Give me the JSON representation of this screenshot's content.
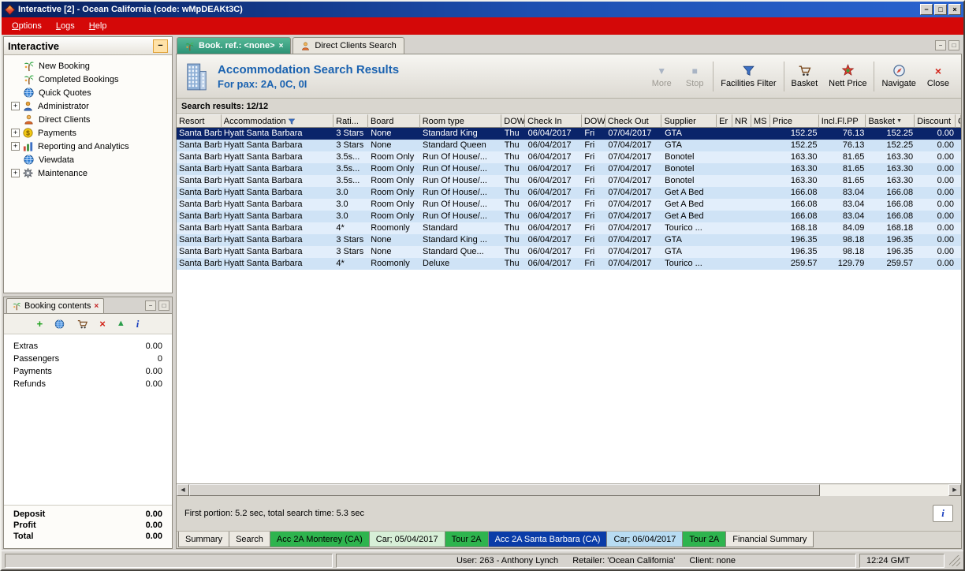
{
  "window": {
    "title": "Interactive [2] - Ocean California (code: wMpDEAKt3C)",
    "status_user": "User: 263 - Anthony Lynch",
    "status_retailer": "Retailer: 'Ocean California'",
    "status_client": "Client: none",
    "time": "12:24 GMT"
  },
  "colors": {
    "titlebar": "#0a2a6e",
    "menubar_red": "#d40808",
    "accent_blue": "#1a62b0",
    "selected_row": "#0a246a",
    "active_doc_tab_green": "#35a081",
    "bottom_tab_green": "#2eb44e",
    "bottom_tab_active_blue": "#0a3ca8",
    "bottom_tab_pale_blue": "#b8dcf2"
  },
  "icons": {
    "minimize": "−",
    "maximize": "□",
    "close": "×",
    "expander": "+",
    "more": "▼",
    "stop": "■",
    "tab_close": "×",
    "add": "+",
    "remove": "×",
    "move_up": "▲",
    "info": "i",
    "scroll_left": "◀",
    "scroll_right": "▶",
    "sort": "▼"
  },
  "menu": {
    "items": [
      {
        "label": "Options"
      },
      {
        "label": "Logs"
      },
      {
        "label": "Help"
      }
    ]
  },
  "sidebar": {
    "title": "Interactive",
    "items": [
      {
        "label": "New Booking"
      },
      {
        "label": "Completed Bookings"
      },
      {
        "label": "Quick Quotes"
      },
      {
        "label": "Administrator"
      },
      {
        "label": "Direct Clients"
      },
      {
        "label": "Payments"
      },
      {
        "label": "Reporting and Analytics"
      },
      {
        "label": "Viewdata"
      },
      {
        "label": "Maintenance"
      }
    ]
  },
  "booking_contents": {
    "title": "Booking contents",
    "rows": [
      {
        "label": "Extras",
        "value": "0.00"
      },
      {
        "label": "Passengers",
        "value": "0"
      },
      {
        "label": "Payments",
        "value": "0.00"
      },
      {
        "label": "Refunds",
        "value": "0.00"
      }
    ],
    "totals": [
      {
        "label": "Deposit",
        "value": "0.00"
      },
      {
        "label": "Profit",
        "value": "0.00"
      },
      {
        "label": "Total",
        "value": "0.00"
      }
    ]
  },
  "doc_tabs": {
    "booking": "Book. ref.: <none>",
    "direct_clients": "Direct Clients Search"
  },
  "results_header": {
    "title": "Accommodation Search Results",
    "subtitle": "For pax: 2A, 0C, 0I",
    "toolbar": {
      "more": "More",
      "stop": "Stop",
      "facilities_filter": "Facilities Filter",
      "basket": "Basket",
      "nett_price": "Nett Price",
      "navigate": "Navigate",
      "close": "Close"
    }
  },
  "results": {
    "summary": "Search results: 12/12",
    "footer": "First portion: 5.2 sec, total search time: 5.3 sec",
    "columns": [
      "Resort",
      "Accommodation",
      "Rati...",
      "Board",
      "Room type",
      "DOW",
      "Check In",
      "DOW",
      "Check Out",
      "Supplier",
      "Er",
      "NR",
      "MS",
      "Price",
      "Incl.Fl.PP",
      "Basket",
      "Discount",
      "C"
    ],
    "rows": [
      {
        "state": "selected",
        "resort": "Santa Barb...",
        "accommodation": "Hyatt Santa Barbara",
        "rating": "3 Stars",
        "board": "None",
        "room_type": "Standard King",
        "dow_in": "Thu",
        "check_in": "06/04/2017",
        "dow_out": "Fri",
        "check_out": "07/04/2017",
        "supplier": "GTA",
        "er": "",
        "nr": "",
        "ms": "",
        "price": "152.25",
        "incl_fl_pp": "76.13",
        "basket": "152.25",
        "discount": "0.00"
      },
      {
        "resort": "Santa Barb...",
        "accommodation": "Hyatt Santa Barbara",
        "rating": "3 Stars",
        "board": "None",
        "room_type": "Standard Queen",
        "dow_in": "Thu",
        "check_in": "06/04/2017",
        "dow_out": "Fri",
        "check_out": "07/04/2017",
        "supplier": "GTA",
        "er": "",
        "nr": "",
        "ms": "",
        "price": "152.25",
        "incl_fl_pp": "76.13",
        "basket": "152.25",
        "discount": "0.00"
      },
      {
        "resort": "Santa Barb...",
        "accommodation": "Hyatt Santa Barbara",
        "rating": "3.5s...",
        "board": "Room Only",
        "room_type": "Run Of House/...",
        "dow_in": "Thu",
        "check_in": "06/04/2017",
        "dow_out": "Fri",
        "check_out": "07/04/2017",
        "supplier": "Bonotel",
        "er": "",
        "nr": "",
        "ms": "",
        "price": "163.30",
        "incl_fl_pp": "81.65",
        "basket": "163.30",
        "discount": "0.00"
      },
      {
        "resort": "Santa Barb...",
        "accommodation": "Hyatt Santa Barbara",
        "rating": "3.5s...",
        "board": "Room Only",
        "room_type": "Run Of House/...",
        "dow_in": "Thu",
        "check_in": "06/04/2017",
        "dow_out": "Fri",
        "check_out": "07/04/2017",
        "supplier": "Bonotel",
        "er": "",
        "nr": "",
        "ms": "",
        "price": "163.30",
        "incl_fl_pp": "81.65",
        "basket": "163.30",
        "discount": "0.00"
      },
      {
        "resort": "Santa Barb...",
        "accommodation": "Hyatt Santa Barbara",
        "rating": "3.5s...",
        "board": "Room Only",
        "room_type": "Run Of House/...",
        "dow_in": "Thu",
        "check_in": "06/04/2017",
        "dow_out": "Fri",
        "check_out": "07/04/2017",
        "supplier": "Bonotel",
        "er": "",
        "nr": "",
        "ms": "",
        "price": "163.30",
        "incl_fl_pp": "81.65",
        "basket": "163.30",
        "discount": "0.00"
      },
      {
        "resort": "Santa Barb...",
        "accommodation": "Hyatt Santa Barbara",
        "rating": "3.0",
        "board": "Room Only",
        "room_type": "Run Of House/...",
        "dow_in": "Thu",
        "check_in": "06/04/2017",
        "dow_out": "Fri",
        "check_out": "07/04/2017",
        "supplier": "Get A Bed",
        "er": "",
        "nr": "",
        "ms": "",
        "price": "166.08",
        "incl_fl_pp": "83.04",
        "basket": "166.08",
        "discount": "0.00"
      },
      {
        "resort": "Santa Barb...",
        "accommodation": "Hyatt Santa Barbara",
        "rating": "3.0",
        "board": "Room Only",
        "room_type": "Run Of House/...",
        "dow_in": "Thu",
        "check_in": "06/04/2017",
        "dow_out": "Fri",
        "check_out": "07/04/2017",
        "supplier": "Get A Bed",
        "er": "",
        "nr": "",
        "ms": "",
        "price": "166.08",
        "incl_fl_pp": "83.04",
        "basket": "166.08",
        "discount": "0.00"
      },
      {
        "resort": "Santa Barb...",
        "accommodation": "Hyatt Santa Barbara",
        "rating": "3.0",
        "board": "Room Only",
        "room_type": "Run Of House/...",
        "dow_in": "Thu",
        "check_in": "06/04/2017",
        "dow_out": "Fri",
        "check_out": "07/04/2017",
        "supplier": "Get A Bed",
        "er": "",
        "nr": "",
        "ms": "",
        "price": "166.08",
        "incl_fl_pp": "83.04",
        "basket": "166.08",
        "discount": "0.00"
      },
      {
        "resort": "Santa Barb...",
        "accommodation": "Hyatt Santa Barbara",
        "rating": "4*",
        "board": "Roomonly",
        "room_type": "Standard",
        "dow_in": "Thu",
        "check_in": "06/04/2017",
        "dow_out": "Fri",
        "check_out": "07/04/2017",
        "supplier": "Tourico ...",
        "er": "",
        "nr": "",
        "ms": "",
        "price": "168.18",
        "incl_fl_pp": "84.09",
        "basket": "168.18",
        "discount": "0.00"
      },
      {
        "resort": "Santa Barb...",
        "accommodation": "Hyatt Santa Barbara",
        "rating": "3 Stars",
        "board": "None",
        "room_type": "Standard King ...",
        "dow_in": "Thu",
        "check_in": "06/04/2017",
        "dow_out": "Fri",
        "check_out": "07/04/2017",
        "supplier": "GTA",
        "er": "",
        "nr": "",
        "ms": "",
        "price": "196.35",
        "incl_fl_pp": "98.18",
        "basket": "196.35",
        "discount": "0.00"
      },
      {
        "resort": "Santa Barb...",
        "accommodation": "Hyatt Santa Barbara",
        "rating": "3 Stars",
        "board": "None",
        "room_type": "Standard Que...",
        "dow_in": "Thu",
        "check_in": "06/04/2017",
        "dow_out": "Fri",
        "check_out": "07/04/2017",
        "supplier": "GTA",
        "er": "",
        "nr": "",
        "ms": "",
        "price": "196.35",
        "incl_fl_pp": "98.18",
        "basket": "196.35",
        "discount": "0.00"
      },
      {
        "resort": "Santa Barb...",
        "accommodation": "Hyatt Santa Barbara",
        "rating": "4*",
        "board": "Roomonly",
        "room_type": "Deluxe",
        "dow_in": "Thu",
        "check_in": "06/04/2017",
        "dow_out": "Fri",
        "check_out": "07/04/2017",
        "supplier": "Tourico ...",
        "er": "",
        "nr": "",
        "ms": "",
        "price": "259.57",
        "incl_fl_pp": "129.79",
        "basket": "259.57",
        "discount": "0.00"
      }
    ]
  },
  "bottom_tabs": [
    {
      "label": "Summary",
      "type": "plain"
    },
    {
      "label": "Search",
      "type": "plain"
    },
    {
      "label": "Acc 2A Monterey (CA)",
      "type": "green"
    },
    {
      "label": "Car; 05/04/2017",
      "type": "palegreen"
    },
    {
      "label": "Tour 2A",
      "type": "green"
    },
    {
      "label": "Acc 2A Santa Barbara (CA)",
      "type": "active"
    },
    {
      "label": "Car; 06/04/2017",
      "type": "paleblue"
    },
    {
      "label": "Tour 2A",
      "type": "green"
    },
    {
      "label": "Financial Summary",
      "type": "plain"
    }
  ]
}
